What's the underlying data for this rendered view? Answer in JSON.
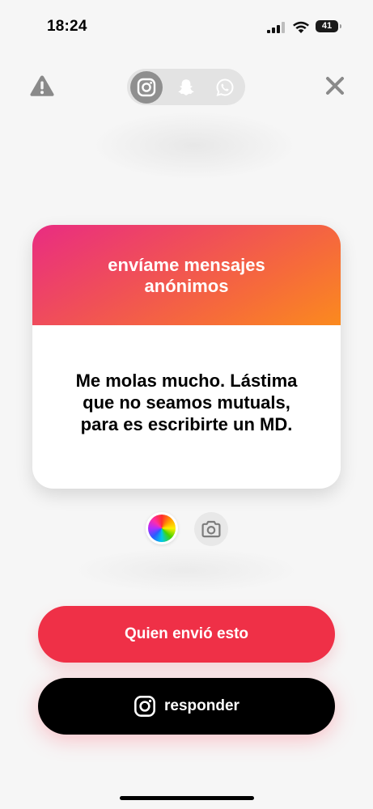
{
  "status_bar": {
    "time": "18:24",
    "battery": "41"
  },
  "share_options": [
    {
      "name": "instagram",
      "icon": "instagram-icon",
      "selected": true
    },
    {
      "name": "snapchat",
      "icon": "snapchat-icon",
      "selected": false
    },
    {
      "name": "whatsapp",
      "icon": "whatsapp-icon",
      "selected": false
    }
  ],
  "card": {
    "title": "envíame mensajes anónimos",
    "message": "Me molas mucho. Lástima que no seamos mutuals, para es escribirte un MD."
  },
  "buttons": {
    "who_sent": "Quien envió esto",
    "reply": "responder"
  },
  "colors": {
    "accent": "#ef3047",
    "gradient_start": "#e92c82",
    "gradient_end": "#fb8a1e",
    "reply_button": "#000000"
  }
}
